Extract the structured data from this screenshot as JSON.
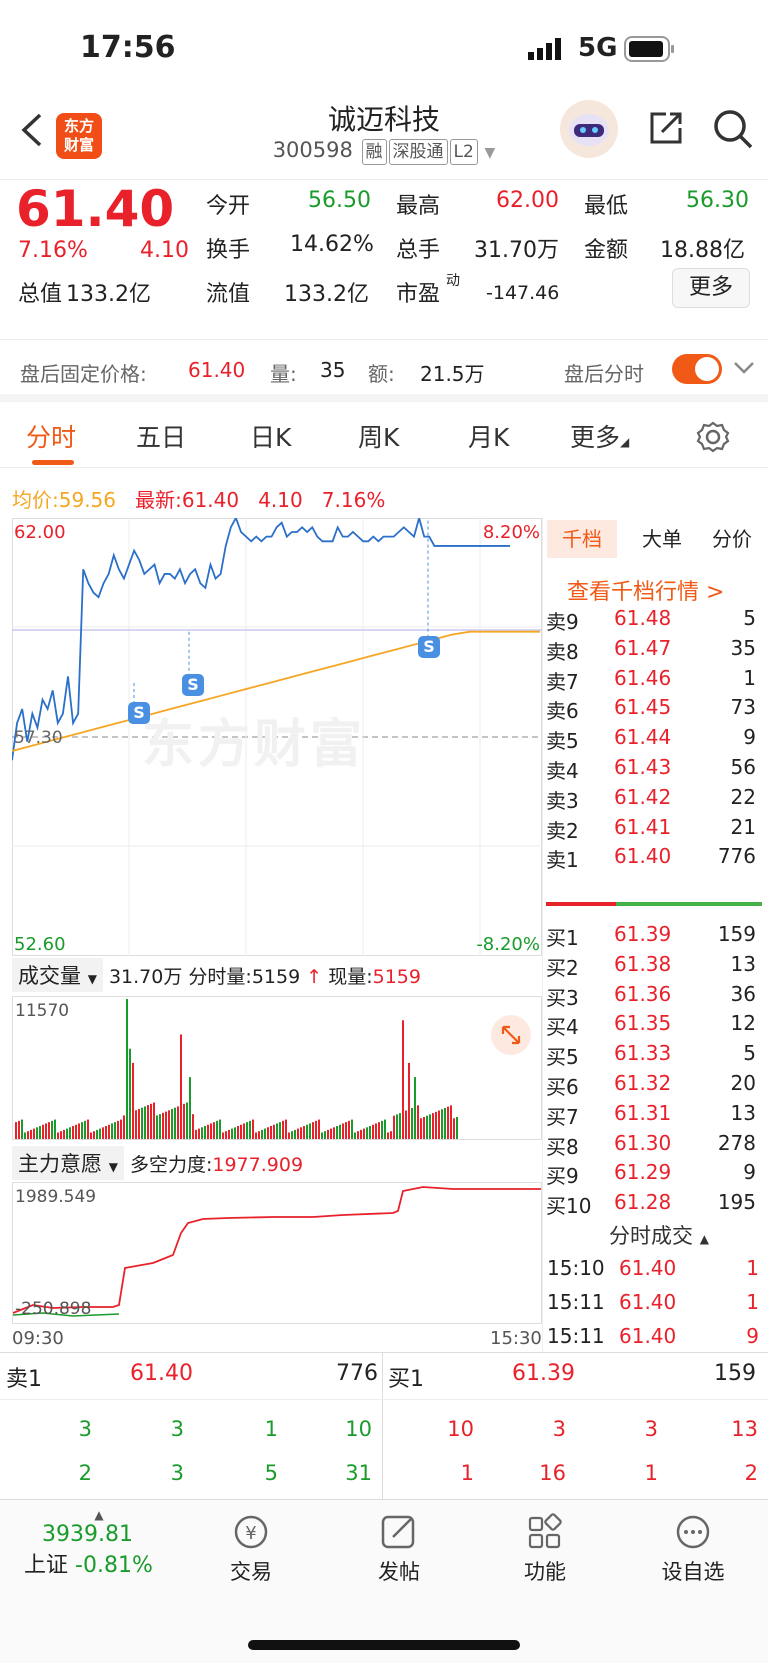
{
  "status": {
    "time": "17:56",
    "network": "5G"
  },
  "header": {
    "logo": "东方\n财富",
    "title": "诚迈科技",
    "code": "300598",
    "tags": [
      "融",
      "深股通",
      "L2"
    ]
  },
  "quote": {
    "price": "61.40",
    "pct": "7.16%",
    "change": "4.10",
    "labels": {
      "open": "今开",
      "high": "最高",
      "low": "最低",
      "turnover": "换手",
      "volume": "总手",
      "amount": "金额",
      "mktcap": "总值",
      "float": "流值",
      "pe": "市盈",
      "pe_sup": "动"
    },
    "open": "56.50",
    "high": "62.00",
    "low": "56.30",
    "turnover": "14.62%",
    "volume": "31.70万",
    "amount": "18.88亿",
    "mktcap": "133.2亿",
    "float": "133.2亿",
    "pe": "-147.46",
    "more": "更多"
  },
  "after": {
    "label": "盘后固定价格:",
    "price": "61.40",
    "vol_label": "量:",
    "vol": "35",
    "amt_label": "额:",
    "amt": "21.5万",
    "toggle_label": "盘后分时"
  },
  "tabs": [
    "分时",
    "五日",
    "日K",
    "周K",
    "月K",
    "更多"
  ],
  "summary": {
    "avg_label": "均价:",
    "avg": "59.56",
    "latest_label": "最新:",
    "latest": "61.40",
    "chg": "4.10",
    "pct": "7.16%"
  },
  "chart": {
    "ymax": "62.00",
    "ymid": "57.30",
    "ymin": "52.60",
    "pct_up": "8.20%",
    "pct_down": "-8.20%",
    "watermark": "东方财富",
    "t_start": "09:30",
    "t_end": "15:30"
  },
  "chart_data": {
    "type": "line",
    "title": "",
    "x": [
      "09:30",
      "15:30"
    ],
    "series": [
      {
        "name": "",
        "color": "#2a6fc9",
        "values": [
          56.8,
          57.6,
          57.9,
          57.2,
          57.8,
          57.5,
          58.1,
          57.9,
          58.3,
          57.6,
          57.8,
          58.6,
          57.6,
          57.8,
          60.9,
          60.6,
          60.4,
          60.3,
          60.6,
          60.8,
          61.2,
          60.9,
          60.7,
          61.0,
          61.3,
          61.1,
          60.8,
          60.9,
          61.0,
          60.6,
          60.8,
          60.8,
          60.7,
          60.9,
          60.6,
          60.8,
          60.9,
          60.6,
          60.5,
          61.0,
          60.7,
          60.8,
          61.4,
          61.8,
          62.0,
          61.7,
          61.6,
          61.5,
          61.6,
          61.5,
          61.6,
          61.6,
          61.8,
          61.9,
          61.6,
          61.7,
          61.7,
          61.8,
          61.7,
          61.8,
          61.6,
          61.5,
          61.5,
          61.5,
          61.8,
          61.6,
          61.6,
          61.7,
          61.6,
          61.5,
          61.5,
          61.6,
          61.5,
          61.6,
          61.6,
          61.6,
          61.7,
          61.8,
          61.7,
          61.6,
          62.0,
          61.6,
          61.6,
          61.4,
          61.4,
          61.4,
          61.4,
          61.4,
          61.4,
          61.4,
          61.4
        ]
      },
      {
        "name": "",
        "color": "#f5a623",
        "values": [
          57.0,
          57.1,
          57.2,
          57.3,
          57.4,
          57.5,
          57.6,
          57.7,
          57.8,
          57.9,
          58.0,
          58.1,
          58.2,
          58.3,
          58.4,
          58.5,
          58.6,
          58.7,
          58.8,
          58.9,
          59.0,
          59.1,
          59.2,
          59.3,
          59.4,
          59.5,
          59.56
        ]
      }
    ],
    "ylim": [
      52.6,
      62.0
    ]
  },
  "volume": {
    "label": "成交量",
    "total": "31.70万",
    "min_label": "分时量:",
    "min_vol": "5159",
    "now_label": "现量:",
    "now_vol": "5159",
    "max": "11570"
  },
  "force": {
    "label": "主力意愿",
    "ratio_label": "多空力度:",
    "ratio": "1977.909",
    "max": "1989.549",
    "min": "-250.898"
  },
  "orderbook": {
    "tabs": [
      "千档",
      "大单",
      "分价"
    ],
    "link": "查看千档行情 >",
    "sells": [
      [
        "卖9",
        "61.48",
        "5"
      ],
      [
        "卖8",
        "61.47",
        "35"
      ],
      [
        "卖7",
        "61.46",
        "1"
      ],
      [
        "卖6",
        "61.45",
        "73"
      ],
      [
        "卖5",
        "61.44",
        "9"
      ],
      [
        "卖4",
        "61.43",
        "56"
      ],
      [
        "卖3",
        "61.42",
        "22"
      ],
      [
        "卖2",
        "61.41",
        "21"
      ],
      [
        "卖1",
        "61.40",
        "776"
      ]
    ],
    "buys": [
      [
        "买1",
        "61.39",
        "159"
      ],
      [
        "买2",
        "61.38",
        "13"
      ],
      [
        "买3",
        "61.36",
        "36"
      ],
      [
        "买4",
        "61.35",
        "12"
      ],
      [
        "买5",
        "61.33",
        "5"
      ],
      [
        "买6",
        "61.32",
        "20"
      ],
      [
        "买7",
        "61.31",
        "13"
      ],
      [
        "买8",
        "61.30",
        "278"
      ],
      [
        "买9",
        "61.29",
        "9"
      ],
      [
        "买10",
        "61.28",
        "195"
      ]
    ]
  },
  "ticks": {
    "title": "分时成交",
    "rows": [
      [
        "15:10",
        "61.40",
        "1"
      ],
      [
        "15:11",
        "61.40",
        "1"
      ],
      [
        "15:11",
        "61.40",
        "9"
      ]
    ]
  },
  "bottom": {
    "sell1": [
      "卖1",
      "61.40",
      "776"
    ],
    "buy1": [
      "买1",
      "61.39",
      "159"
    ],
    "row1": [
      "3",
      "3",
      "1",
      "10",
      "10",
      "3",
      "3",
      "13"
    ],
    "row2": [
      "2",
      "3",
      "5",
      "31",
      "1",
      "16",
      "1",
      "2"
    ]
  },
  "nav": {
    "index_val": "3939.81",
    "index_name": "上证",
    "index_pct": "-0.81%",
    "items": [
      "交易",
      "发帖",
      "功能",
      "设自选"
    ]
  }
}
